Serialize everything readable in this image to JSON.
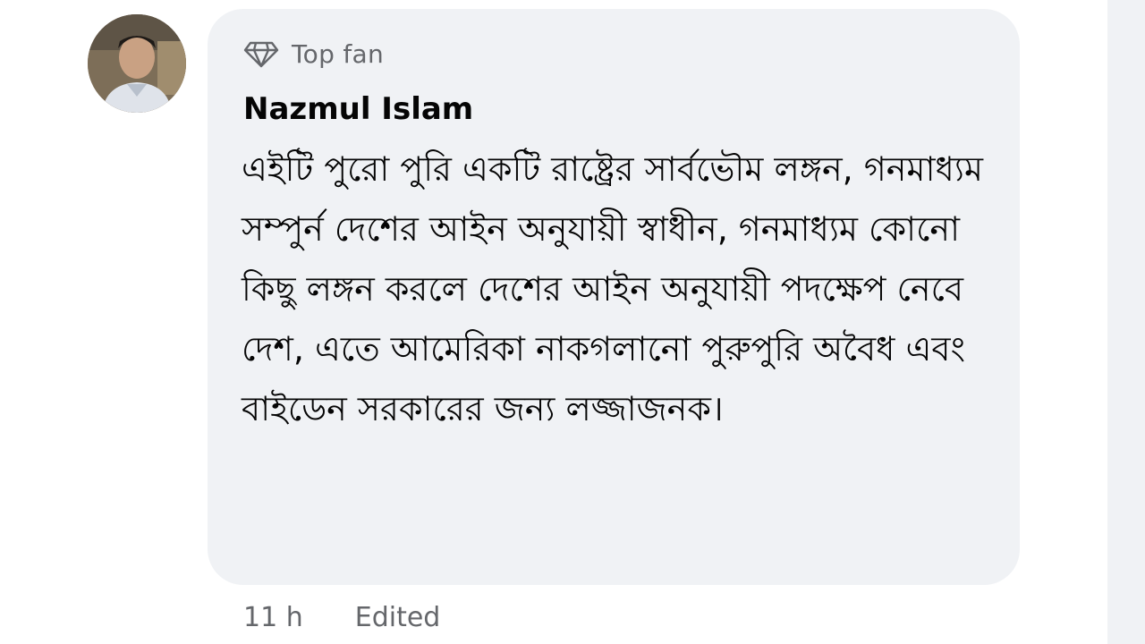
{
  "comment": {
    "author": {
      "name": "Nazmul Islam",
      "avatar_icon": "user-avatar-photo"
    },
    "badge": {
      "icon": "diamond-icon",
      "label": "Top fan"
    },
    "text": "এইটি পুরো পুরি একটি রাষ্ট্রের সার্বভৌম লঙ্গন, গনমাধ্যম সম্পুর্ন দেশের আইন অনুযায়ী স্বাধীন, গনমাধ্যম কোনো কিছু লঙ্গন করলে দেশের আইন অনুযায়ী পদক্ষেপ নেবে দেশ, এতে আমেরিকা নাকগলানো পুরুপুরি অবৈধ এবং বাইডেন সরকারের জন্য লজ্জাজনক।",
    "timestamp": "11 h",
    "edited_label": "Edited"
  },
  "colors": {
    "bubble_bg": "#f0f2f5",
    "secondary_text": "#65676b",
    "primary_text": "#050505"
  }
}
